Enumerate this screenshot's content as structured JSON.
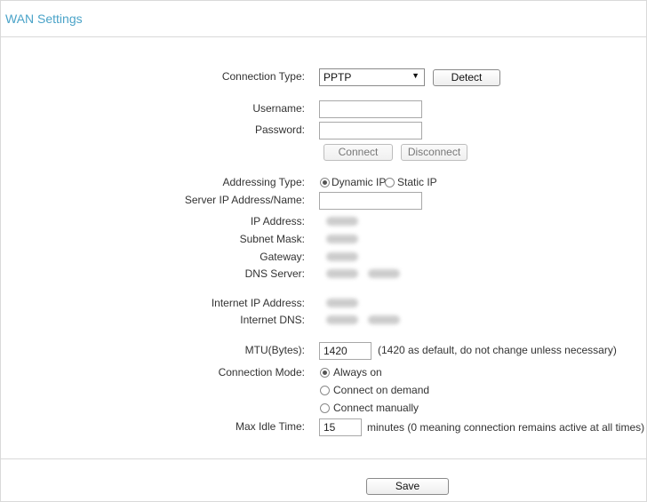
{
  "header": {
    "title": "WAN Settings"
  },
  "connection_type": {
    "label": "Connection Type:",
    "selected": "PPTP",
    "detect_label": "Detect"
  },
  "username": {
    "label": "Username:",
    "value": ""
  },
  "password": {
    "label": "Password:",
    "value": ""
  },
  "connect_buttons": {
    "connect": "Connect",
    "disconnect": "Disconnect"
  },
  "addressing": {
    "label": "Addressing Type:",
    "options": [
      {
        "label": "Dynamic IP",
        "checked": true
      },
      {
        "label": "Static IP",
        "checked": false
      }
    ]
  },
  "server": {
    "label": "Server IP Address/Name:",
    "value": ""
  },
  "info": {
    "ip_label": "IP Address:",
    "subnet_label": "Subnet Mask:",
    "gateway_label": "Gateway:",
    "dns_label": "DNS Server:",
    "internet_ip_label": "Internet IP Address:",
    "internet_dns_label": "Internet DNS:"
  },
  "mtu": {
    "label": "MTU(Bytes):",
    "value": "1420",
    "hint": "(1420 as default, do not change unless necessary)"
  },
  "connection_mode": {
    "label": "Connection Mode:",
    "options": [
      {
        "label": "Always on",
        "checked": true
      },
      {
        "label": "Connect on demand",
        "checked": false
      },
      {
        "label": "Connect manually",
        "checked": false
      }
    ]
  },
  "idle": {
    "label": "Max Idle Time:",
    "value": "15",
    "hint": "minutes (0 meaning connection remains active at all times)"
  },
  "footer": {
    "save_label": "Save"
  },
  "colors": {
    "title": "#4aa3c8",
    "border": "#d9d9d9"
  }
}
